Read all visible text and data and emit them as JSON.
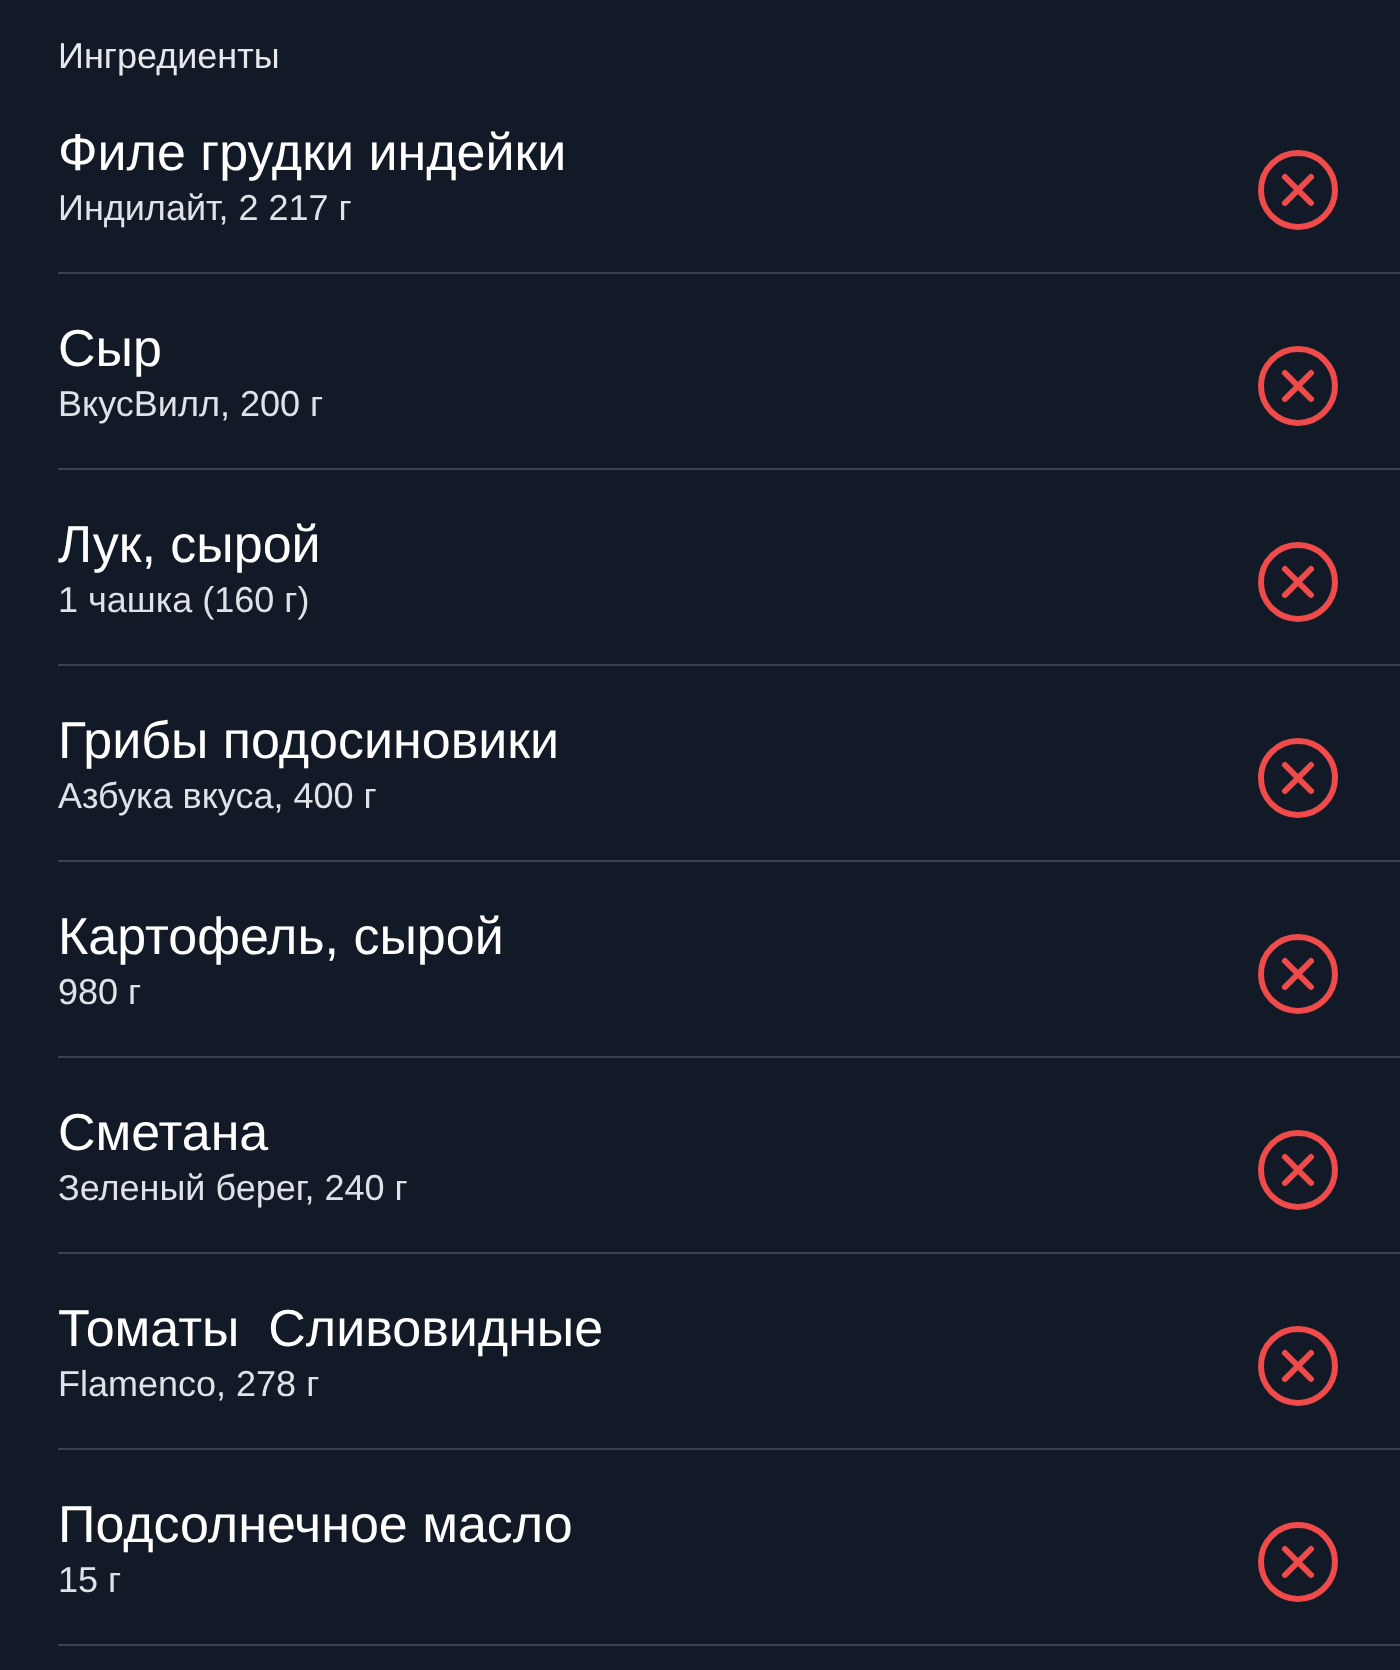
{
  "section_title": "Ингредиенты",
  "ingredients": [
    {
      "name": "Филе грудки индейки",
      "detail": "Индилайт, 2 217 г"
    },
    {
      "name": "Сыр",
      "detail": "ВкусВилл, 200 г"
    },
    {
      "name": "Лук, сырой",
      "detail": "1 чашка (160 г)"
    },
    {
      "name": "Грибы подосиновики",
      "detail": "Азбука вкуса, 400 г"
    },
    {
      "name": "Картофель, сырой",
      "detail": "980 г"
    },
    {
      "name": "Сметана",
      "detail": "Зеленый берег, 240 г"
    },
    {
      "name": "Томаты  Сливовидные",
      "detail": "Flamenco, 278 г"
    },
    {
      "name": "Подсолнечное масло",
      "detail": "15 г"
    }
  ]
}
